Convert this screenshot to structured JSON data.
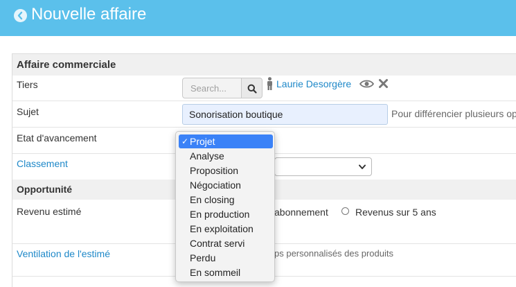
{
  "header": {
    "title": "Nouvelle affaire",
    "back_icon": "back-arrow-circle-icon",
    "background": "#5bc0eb"
  },
  "sections": {
    "business": "Affaire commerciale",
    "opportunity": "Opportunité"
  },
  "fields": {
    "tiers_label": "Tiers",
    "tiers_search_placeholder": "Search...",
    "tiers_value": "Laurie Desorgère",
    "subject_label": "Sujet",
    "subject_value": "Sonorisation boutique",
    "subject_hint": "Pour différencier plusieurs op",
    "stage_label": "Etat d'avancement",
    "classement_label": "Classement",
    "revenue_label": "Revenu estimé",
    "revenue_option_subscription": "abonnement",
    "revenue_option_five_years": "Revenus sur 5 ans",
    "breakdown_label": "Ventilation de l'estimé",
    "breakdown_text": "ps personnalisés des produits"
  },
  "stage_dropdown": {
    "selected": "Projet",
    "options": [
      "Projet",
      "Analyse",
      "Proposition",
      "Négociation",
      "En closing",
      "En production",
      "En exploitation",
      "Contrat servi",
      "Perdu",
      "En sommeil"
    ]
  },
  "colors": {
    "link": "#1e88c8",
    "selected": "#3b82f7"
  }
}
